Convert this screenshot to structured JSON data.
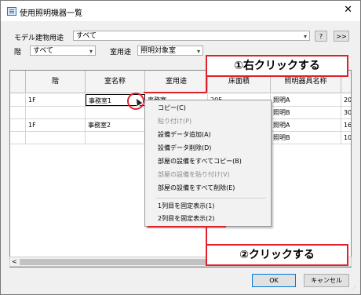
{
  "window": {
    "title": "使用照明機器一覧",
    "close_glyph": "✕"
  },
  "filters": {
    "building_use_label": "モデル建物用途",
    "building_use_value": "すべて",
    "help_label": "?",
    "expand_label": ">>",
    "floor_label": "階",
    "floor_value": "すべて",
    "room_use_label": "室用途",
    "room_use_value": "照明対象室"
  },
  "grid": {
    "columns": [
      "",
      "階",
      "室名称",
      "室用途",
      "床面積",
      "照明器具名称",
      ""
    ],
    "rows": [
      [
        "",
        "1F",
        "事務室1",
        "事務室",
        "205",
        "照明A",
        "20"
      ],
      [
        "",
        "",
        "",
        "",
        "",
        "照明B",
        "30"
      ],
      [
        "",
        "1F",
        "事務室2",
        "",
        "",
        "照明A",
        "16"
      ],
      [
        "",
        "",
        "",
        "",
        "",
        "照明B",
        "10"
      ]
    ]
  },
  "context_menu": {
    "items": [
      {
        "label": "コピー(C)",
        "enabled": true
      },
      {
        "label": "貼り付け(P)",
        "enabled": false
      },
      {
        "label": "設備データ追加(A)",
        "enabled": true
      },
      {
        "label": "設備データ削除(D)",
        "enabled": true
      },
      {
        "label": "部屋の設備をすべてコピー(B)",
        "enabled": true
      },
      {
        "label": "部屋の設備を貼り付け(V)",
        "enabled": false
      },
      {
        "label": "部屋の設備をすべて削除(E)",
        "enabled": true
      },
      {
        "label": "1列目を固定表示(1)",
        "enabled": true
      },
      {
        "label": "2列目を固定表示(2)",
        "enabled": true
      }
    ]
  },
  "annotations": {
    "step1": "①右クリックする",
    "step2": "②クリックする",
    "accent_color": "#e0202a"
  },
  "scrollbar": {
    "left_arrow": "<"
  },
  "buttons": {
    "ok": "OK",
    "cancel": "キャンセル"
  }
}
